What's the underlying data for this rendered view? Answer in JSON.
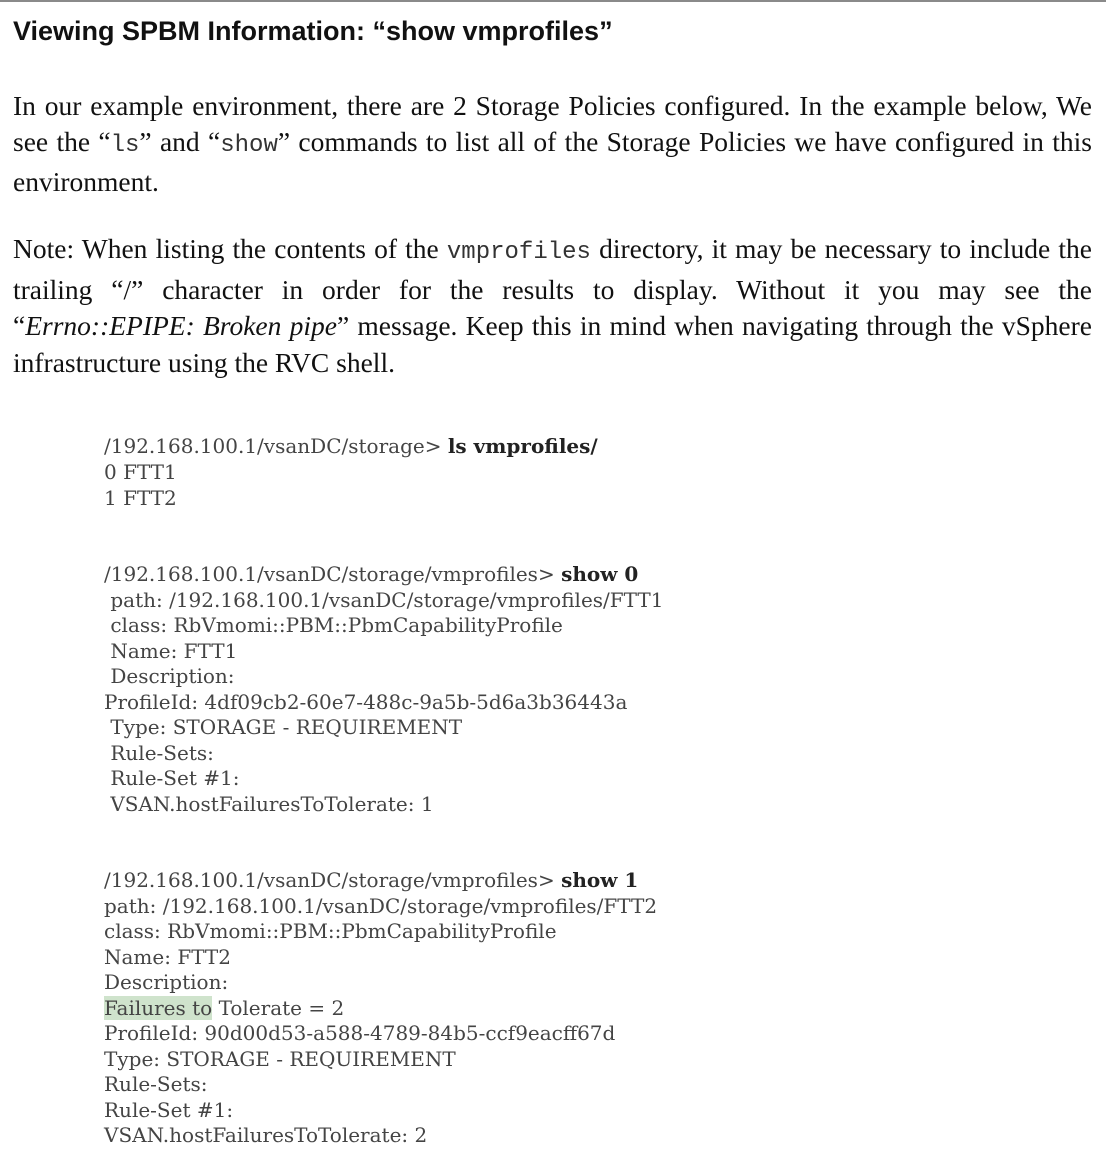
{
  "heading": "Viewing SPBM Information: “show vmprofiles”",
  "para1": {
    "t1": "In our example environment, there are 2 Storage Policies configured. In the example below, We see the “",
    "code1": "ls",
    "t2": "” and “",
    "code2": "show",
    "t3": "” commands to list all of the Storage Policies we have configured in this environment."
  },
  "para2": {
    "t1": "Note: When listing the contents of the ",
    "code1": "vmprofiles",
    "t2": " directory, it may be necessary to include the trailing “/” character in order for the results to display. Without it you may see the “",
    "em": "Errno::EPIPE: Broken pipe",
    "t3": "” message. Keep this in mind when navigating through the vSphere infrastructure using the RVC shell."
  },
  "block1": {
    "prompt": "/192.168.100.1/vsanDC/storage> ",
    "cmd": "ls vmprofiles/",
    "lines": [
      "0 FTT1",
      "1 FTT2"
    ]
  },
  "block2": {
    "prompt": "/192.168.100.1/vsanDC/storage/vmprofiles> ",
    "cmd": "show 0",
    "lines": [
      " path: /192.168.100.1/vsanDC/storage/vmprofiles/FTT1",
      " class: RbVmomi::PBM::PbmCapabilityProfile",
      " Name: FTT1",
      " Description:",
      "ProfileId: 4df09cb2-60e7-488c-9a5b-5d6a3b36443a",
      " Type: STORAGE - REQUIREMENT",
      " Rule-Sets:",
      " Rule-Set #1:",
      " VSAN.hostFailuresToTolerate: 1"
    ]
  },
  "block3": {
    "prompt": "/192.168.100.1/vsanDC/storage/vmprofiles> ",
    "cmd": "show 1",
    "lines_before": [
      "path: /192.168.100.1/vsanDC/storage/vmprofiles/FTT2",
      "class: RbVmomi::PBM::PbmCapabilityProfile",
      "Name: FTT2",
      "Description:"
    ],
    "highlight": "Failures to",
    "highlight_rest": " Tolerate = 2",
    "lines_after": [
      "ProfileId: 90d00d53-a588-4789-84b5-ccf9eacff67d",
      "Type: STORAGE - REQUIREMENT",
      "Rule-Sets:",
      "Rule-Set #1:",
      "VSAN.hostFailuresToTolerate: 2"
    ]
  },
  "colors": {
    "highlight": "#cfe3cc",
    "code_text": "#444444"
  }
}
